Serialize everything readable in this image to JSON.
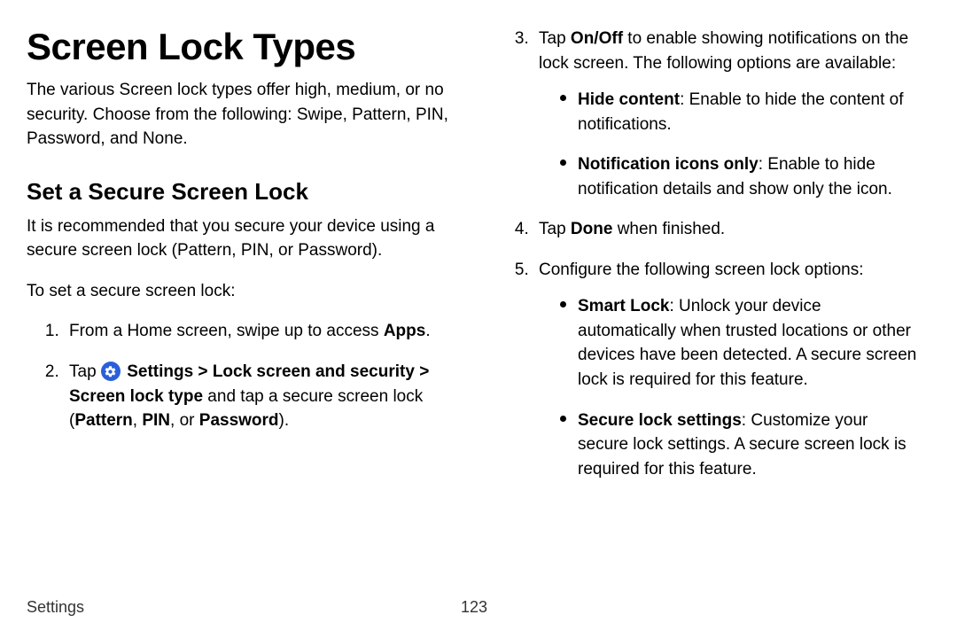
{
  "title": "Screen Lock Types",
  "intro": "The various Screen lock types offer high, medium, or no security. Choose from the following: Swipe, Pattern, PIN, Password, and None.",
  "section_heading": "Set a Secure Screen Lock",
  "section_intro": "It is recommended that you secure your device using a secure screen lock (Pattern, PIN, or Password).",
  "section_lead": "To set a secure screen lock:",
  "step1_pre": "From a Home screen, swipe up to access ",
  "step1_b1": "Apps",
  "step1_post": ".",
  "step2_pre": "Tap ",
  "step2_b1": "Settings",
  "step2_sep1": " > ",
  "step2_b2": "Lock screen and security",
  "step2_sep2": " > ",
  "step2_b3": "Screen lock type",
  "step2_mid": " and tap a secure screen lock (",
  "step2_b4": "Pattern",
  "step2_c1": ", ",
  "step2_b5": "PIN",
  "step2_c2": ", or ",
  "step2_b6": "Password",
  "step2_end": ").",
  "step3_pre": "Tap ",
  "step3_b1": "On/Off",
  "step3_post": " to enable showing notifications on the lock screen. The following options are available:",
  "s3_bul1_b": "Hide content",
  "s3_bul1_t": ": Enable to hide the content of notifications.",
  "s3_bul2_b": "Notification icons only",
  "s3_bul2_t": ": Enable to hide notification details and show only the icon.",
  "step4_pre": "Tap ",
  "step4_b1": "Done",
  "step4_post": " when finished.",
  "step5_text": "Configure the following screen lock options:",
  "s5_bul1_b": "Smart Lock",
  "s5_bul1_t": ": Unlock your device automatically when trusted locations or other devices have been detected. A secure screen lock is required for this feature.",
  "s5_bul2_b": "Secure lock settings",
  "s5_bul2_t": ": Customize your secure lock settings. A secure screen lock is required for this feature.",
  "footer_section": "Settings",
  "footer_page": "123"
}
